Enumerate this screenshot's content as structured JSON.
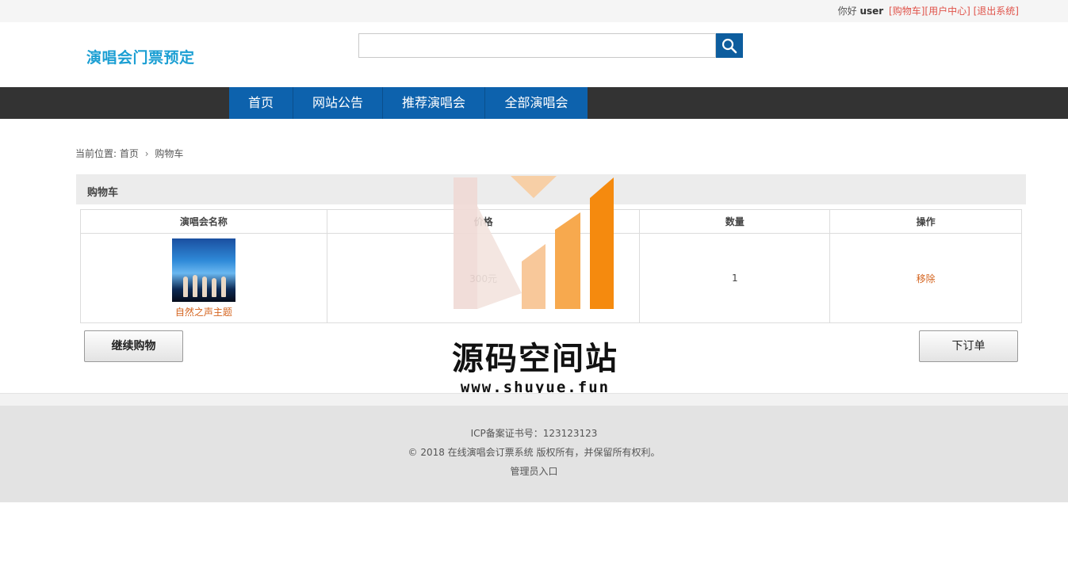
{
  "topbar": {
    "greeting": "你好",
    "username": "user",
    "links": [
      "[购物车]",
      "[用户中心]",
      "[退出系统]"
    ]
  },
  "header": {
    "logo": "演唱会门票预定",
    "search": {
      "value": "",
      "placeholder": ""
    }
  },
  "nav": {
    "items": [
      "首页",
      "网站公告",
      "推荐演唱会",
      "全部演唱会"
    ]
  },
  "breadcrumb": {
    "prefix": "当前位置:",
    "home": "首页",
    "current": "购物车"
  },
  "cart": {
    "title": "购物车",
    "columns": [
      "演唱会名称",
      "价格",
      "数量",
      "操作"
    ],
    "rows": [
      {
        "name": "自然之声主题",
        "price": "300元",
        "quantity": "1",
        "action": "移除"
      }
    ],
    "continue_label": "继续购物",
    "order_label": "下订单"
  },
  "footer": {
    "icp": "ICP备案证书号：123123123",
    "copyright": "© 2018 在线演唱会订票系统 版权所有，并保留所有权利。",
    "admin": "管理员入口"
  },
  "watermark": {
    "title": "源码空间站",
    "url": "www.shuyue.fun"
  },
  "colors": {
    "accent": "#0d62ad",
    "logo": "#1c9fd3",
    "link": "#e0534a",
    "item": "#d4641f",
    "nav_bg": "#333333"
  }
}
